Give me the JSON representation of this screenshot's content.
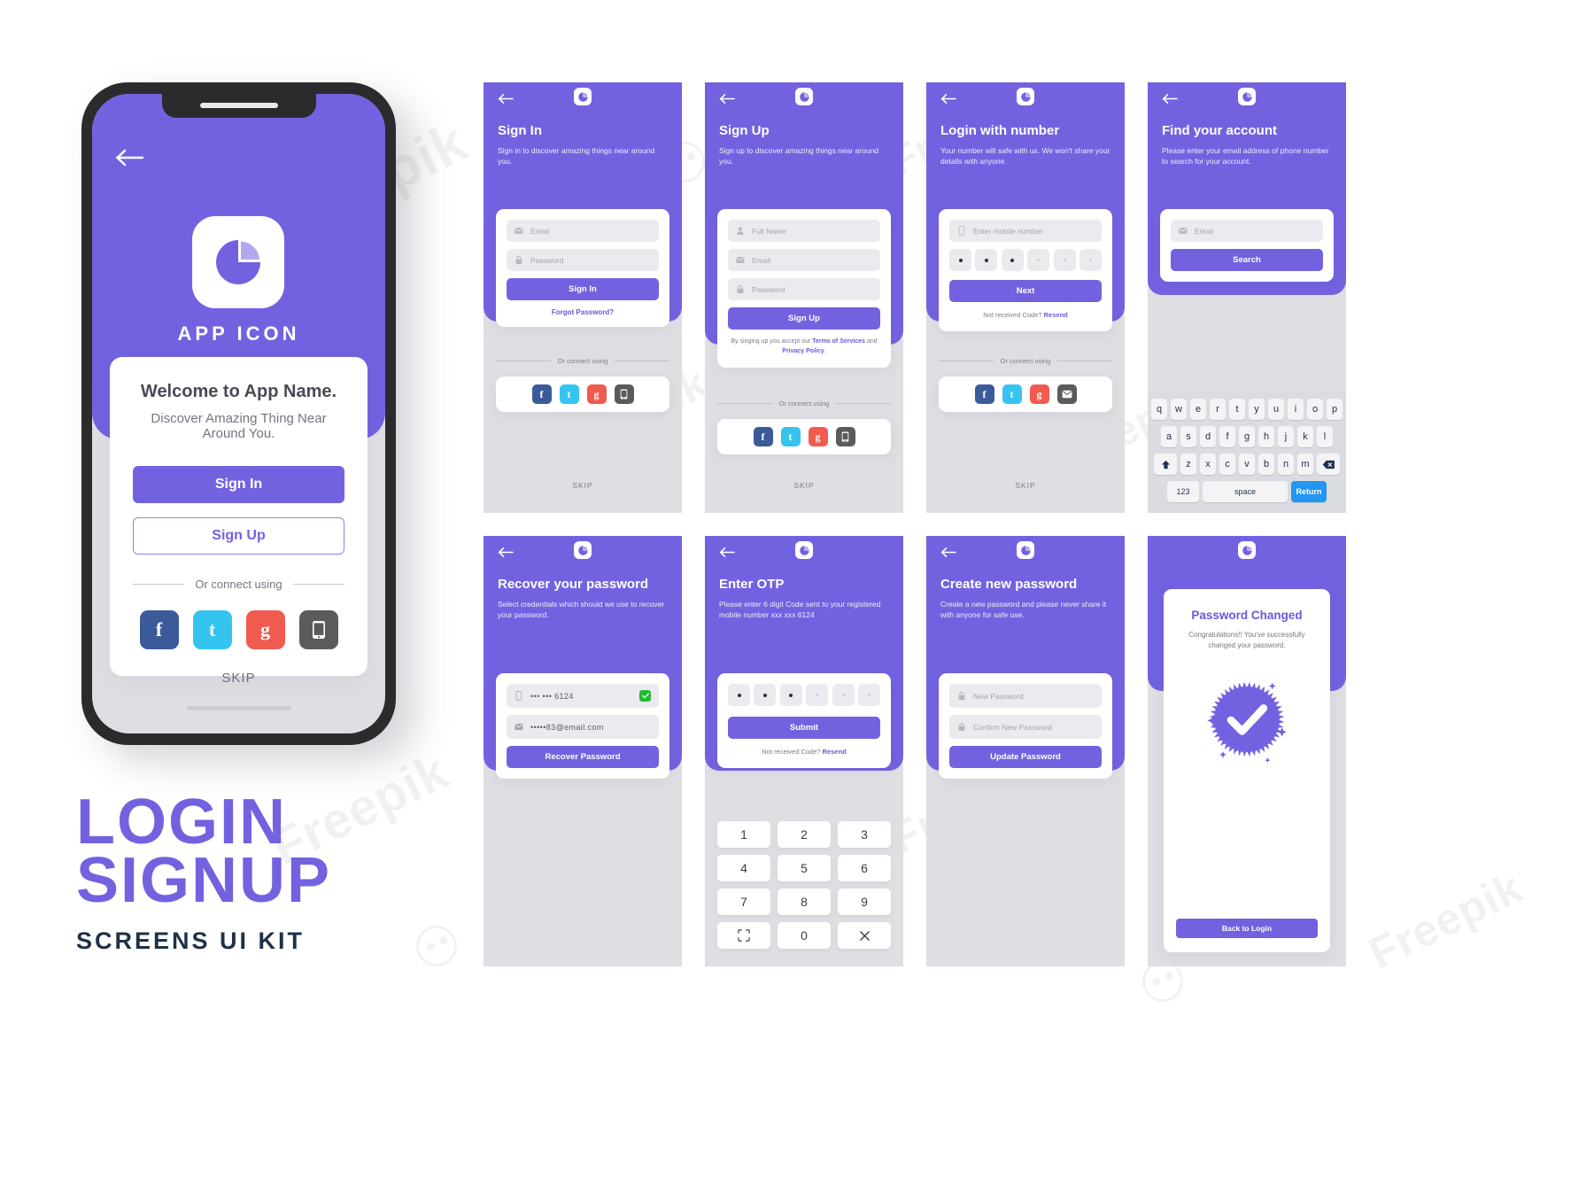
{
  "brand": {
    "primary": "#7362e0",
    "dark_text": "#1f3048",
    "app_icon_label": "APP ICON"
  },
  "kit_title": {
    "line1": "LOGIN",
    "line2": "SIGNUP",
    "subtitle": "SCREENS UI KIT"
  },
  "phone_mockup": {
    "app_icon_label": "APP ICON",
    "welcome_title": "Welcome to App Name.",
    "welcome_subtitle": "Discover Amazing Thing Near Around You.",
    "sign_in_button": "Sign In",
    "sign_up_button": "Sign Up",
    "divider_text": "Or connect using",
    "skip": "SKIP",
    "socials": [
      {
        "name": "facebook",
        "glyph": "f",
        "color": "#3b5a9a"
      },
      {
        "name": "twitter",
        "glyph": "t",
        "color": "#35c4f0"
      },
      {
        "name": "google",
        "glyph": "g",
        "color": "#f05b4f"
      },
      {
        "name": "phone",
        "glyph": "phone-icon",
        "color": "#5b5b5b"
      }
    ]
  },
  "screens": {
    "sign_in": {
      "title": "Sign In",
      "description": "Sign in to discover amazing things near around you.",
      "fields": [
        {
          "icon": "mail-icon",
          "placeholder": "Email"
        },
        {
          "icon": "lock-icon",
          "placeholder": "Password"
        }
      ],
      "submit": "Sign In",
      "link": "Forgot Password?",
      "divider_text": "Or connect using",
      "skip": "SKIP",
      "socials": [
        {
          "name": "facebook",
          "glyph": "f",
          "color": "#3b5a9a"
        },
        {
          "name": "twitter",
          "glyph": "t",
          "color": "#35c4f0"
        },
        {
          "name": "google",
          "glyph": "g",
          "color": "#f05b4f"
        },
        {
          "name": "phone",
          "glyph": "phone-icon",
          "color": "#5b5b5b"
        }
      ]
    },
    "sign_up": {
      "title": "Sign Up",
      "description": "Sign up to discover amazing things near around you.",
      "fields": [
        {
          "icon": "user-icon",
          "placeholder": "Full Name"
        },
        {
          "icon": "mail-icon",
          "placeholder": "Email"
        },
        {
          "icon": "lock-icon",
          "placeholder": "Password"
        }
      ],
      "submit": "Sign Up",
      "terms_prefix": "By singing up you accept our ",
      "terms_link": "Terms of Services",
      "terms_middle": " and ",
      "privacy_link": "Privacy Policy",
      "terms_suffix": ".",
      "divider_text": "Or connect using",
      "skip": "SKIP",
      "socials": [
        {
          "name": "facebook",
          "glyph": "f",
          "color": "#3b5a9a"
        },
        {
          "name": "twitter",
          "glyph": "t",
          "color": "#35c4f0"
        },
        {
          "name": "google",
          "glyph": "g",
          "color": "#f05b4f"
        },
        {
          "name": "phone",
          "glyph": "phone-icon",
          "color": "#5b5b5b"
        }
      ]
    },
    "login_with_number": {
      "title": "Login with number",
      "description": "Your number will safe with us. We won't share your details with anyone.",
      "field": {
        "icon": "phone-icon",
        "placeholder": "Enter mobile number"
      },
      "otp_filled": 3,
      "otp_total": 6,
      "submit": "Next",
      "resend_prefix": "Not received Code? ",
      "resend_link": "Resend",
      "divider_text": "Or connect using",
      "skip": "SKIP",
      "socials": [
        {
          "name": "facebook",
          "glyph": "f",
          "color": "#3b5a9a"
        },
        {
          "name": "twitter",
          "glyph": "t",
          "color": "#35c4f0"
        },
        {
          "name": "google",
          "glyph": "g",
          "color": "#f05b4f"
        },
        {
          "name": "mail",
          "glyph": "mail-icon",
          "color": "#5b5b5b"
        }
      ]
    },
    "find_your_account": {
      "title": "Find your account",
      "description": "Please enter your email address of phone number to search for your account.",
      "field": {
        "icon": "mail-icon",
        "placeholder": "Email"
      },
      "submit": "Search",
      "keyboard": {
        "row1": [
          "q",
          "w",
          "e",
          "r",
          "t",
          "y",
          "u",
          "i",
          "o",
          "p"
        ],
        "row2": [
          "a",
          "s",
          "d",
          "f",
          "g",
          "h",
          "j",
          "k",
          "l"
        ],
        "row3": [
          "shift-icon",
          "z",
          "x",
          "c",
          "v",
          "b",
          "n",
          "m",
          "backspace-icon"
        ],
        "row4": {
          "numbers": "123",
          "space": "space",
          "return": "Return"
        }
      }
    },
    "recover_password": {
      "title": "Recover your password",
      "description": "Select credentials which should we use to recover your password.",
      "options": [
        {
          "icon": "phone-icon",
          "value": "••• ••• 6124",
          "checked": true
        },
        {
          "icon": "mail-icon",
          "value": "•••••83@email.com",
          "checked": false
        }
      ],
      "submit": "Recover Password"
    },
    "enter_otp": {
      "title": "Enter OTP",
      "description": "Please enter 6 digit Code sent to your registered mobile number xxx xxx 6124",
      "otp_filled": 3,
      "otp_total": 6,
      "submit": "Submit",
      "resend_prefix": "Not received Code? ",
      "resend_link": "Resend",
      "numpad": [
        [
          "1",
          "2",
          "3"
        ],
        [
          "4",
          "5",
          "6"
        ],
        [
          "7",
          "8",
          "9"
        ],
        [
          "scan-icon",
          "0",
          "close-icon"
        ]
      ]
    },
    "create_new_password": {
      "title": "Create new password",
      "description": "Create a new password and please never share it with anyone for safe use.",
      "fields": [
        {
          "icon": "lock-icon",
          "placeholder": "New Password"
        },
        {
          "icon": "lock-icon",
          "placeholder": "Confirm New Password"
        }
      ],
      "submit": "Update Password"
    },
    "password_changed": {
      "title": "Password Changed",
      "description": "Congratulations!! You've successfully changed your password.",
      "submit": "Back to Login"
    }
  }
}
